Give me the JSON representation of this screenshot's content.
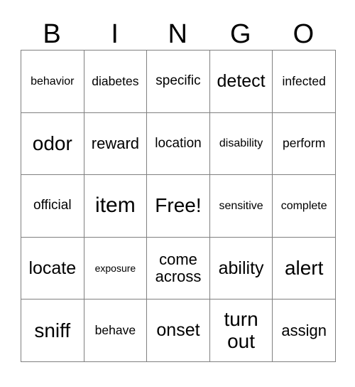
{
  "card": {
    "headers": [
      "B",
      "I",
      "N",
      "G",
      "O"
    ],
    "rows": [
      [
        {
          "text": "behavior",
          "size": "s"
        },
        {
          "text": "diabetes",
          "size": "m"
        },
        {
          "text": "specific",
          "size": "l"
        },
        {
          "text": "detect",
          "size": "xxl"
        },
        {
          "text": "infected",
          "size": "m"
        }
      ],
      [
        {
          "text": "odor",
          "size": "3xl"
        },
        {
          "text": "reward",
          "size": "xl"
        },
        {
          "text": "location",
          "size": "l"
        },
        {
          "text": "disability",
          "size": "s"
        },
        {
          "text": "perform",
          "size": "m"
        }
      ],
      [
        {
          "text": "official",
          "size": "l"
        },
        {
          "text": "item",
          "size": "4xl"
        },
        {
          "text": "Free!",
          "size": "3xl"
        },
        {
          "text": "sensitive",
          "size": "s"
        },
        {
          "text": "complete",
          "size": "s"
        }
      ],
      [
        {
          "text": "locate",
          "size": "xxl"
        },
        {
          "text": "exposure",
          "size": "xs"
        },
        {
          "text": "come across",
          "size": "xl"
        },
        {
          "text": "ability",
          "size": "xxl"
        },
        {
          "text": "alert",
          "size": "3xl"
        }
      ],
      [
        {
          "text": "sniff",
          "size": "3xl"
        },
        {
          "text": "behave",
          "size": "m"
        },
        {
          "text": "onset",
          "size": "xxl"
        },
        {
          "text": "turn out",
          "size": "3xl"
        },
        {
          "text": "assign",
          "size": "xl"
        }
      ]
    ]
  }
}
